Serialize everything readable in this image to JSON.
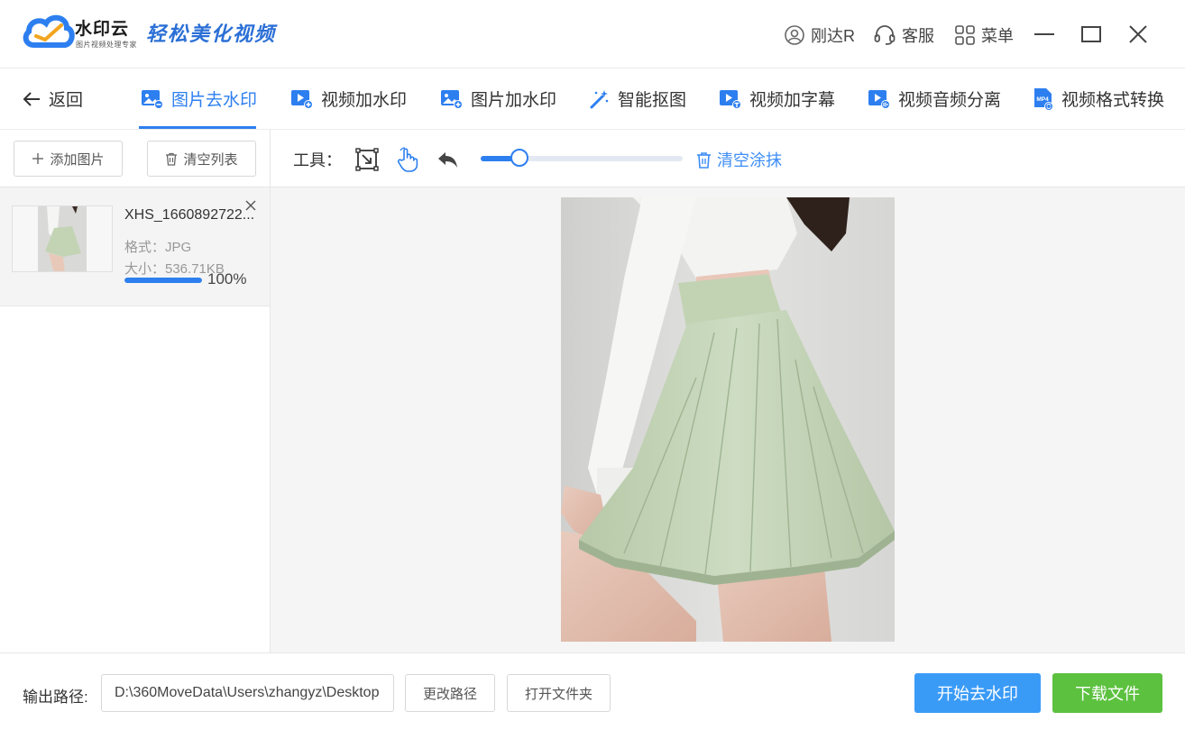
{
  "app": {
    "brand_name": "水印云",
    "brand_sub": "图片视频处理专家",
    "slogan": "轻松美化视频"
  },
  "titlebar": {
    "user_name": "刚达R",
    "service_label": "客服",
    "menu_label": "菜单",
    "icons": [
      "user-icon",
      "headset-icon",
      "grid-icon",
      "minimize-icon",
      "maximize-icon",
      "close-icon"
    ]
  },
  "nav": {
    "back_label": "返回",
    "tabs": [
      {
        "label": "图片去水印",
        "icon": "image-remove-icon",
        "active": true
      },
      {
        "label": "视频加水印",
        "icon": "video-add-icon",
        "active": false
      },
      {
        "label": "图片加水印",
        "icon": "image-add-icon",
        "active": false
      },
      {
        "label": "智能抠图",
        "icon": "magic-wand-icon",
        "active": false
      },
      {
        "label": "视频加字幕",
        "icon": "video-subtitle-icon",
        "active": false
      },
      {
        "label": "视频音频分离",
        "icon": "video-audio-icon",
        "active": false
      },
      {
        "label": "视频格式转换",
        "icon": "mp4-convert-icon",
        "active": false
      }
    ],
    "mp4_badge": "MP4"
  },
  "left_panel": {
    "add_image_label": "添加图片",
    "clear_list_label": "清空列表",
    "file": {
      "name": "XHS_1660892722...",
      "format": "格式：JPG",
      "size": "大小：536.71KB",
      "progress_text": "100%",
      "progress": 1.0
    }
  },
  "editor": {
    "tools_label": "工具：",
    "brush_size": 0.19,
    "clear_paint_label": "清空涂抹"
  },
  "bottom": {
    "output_label": "输出路径:",
    "output_path": "D:\\360MoveData\\Users\\zhangyz\\Desktop",
    "change_path_label": "更改路径",
    "open_folder_label": "打开文件夹",
    "start_label": "开始去水印",
    "download_label": "下载文件"
  },
  "colors": {
    "accent": "#2d7ff0",
    "start_button": "#3a9bf7",
    "download_button": "#5cc13f",
    "skirt": "#c9d8bd",
    "shirt": "#f4f4f2"
  }
}
